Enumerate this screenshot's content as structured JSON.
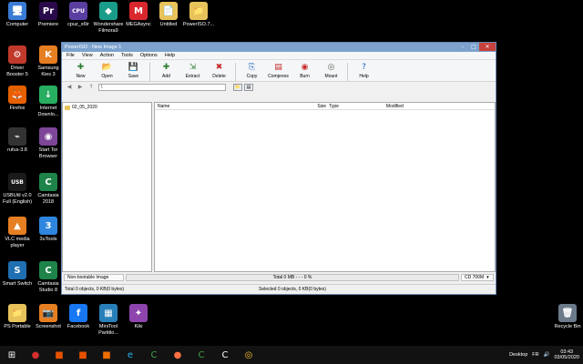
{
  "desktop": {
    "icons": [
      {
        "name": "computer",
        "label": "Computer",
        "glyph": "🖥",
        "color": "#3a7bd5"
      },
      {
        "name": "premiere",
        "label": "Premiere",
        "glyph": "Pr",
        "color": "#2a0a4a"
      },
      {
        "name": "cpuz",
        "label": "cpuz_x6tr",
        "glyph": "CPU",
        "color": "#5b3fa0"
      },
      {
        "name": "wondershare",
        "label": "Wondershare\nFilmora9",
        "glyph": "◆",
        "color": "#1a9c8a"
      },
      {
        "name": "megasync",
        "label": "MEGAsync",
        "glyph": "M",
        "color": "#d9272e"
      },
      {
        "name": "untitled",
        "label": "Untitled",
        "glyph": "📄",
        "color": "#e8c25a"
      },
      {
        "name": "poweriso-shortcut",
        "label": "PowerISO.7...",
        "glyph": "📁",
        "color": "#e8c25a"
      },
      {
        "name": "driver-booster",
        "label": "Driver\nBooster 5",
        "glyph": "⚙",
        "color": "#c0392b"
      },
      {
        "name": "samsung-kies",
        "label": "Samsung\nKies 3",
        "glyph": "K",
        "color": "#e67e22"
      },
      {
        "name": "firefox",
        "label": "Firefox",
        "glyph": "🦊",
        "color": "#e66000"
      },
      {
        "name": "internet-download",
        "label": "Internet\nDownlo...",
        "glyph": "↓",
        "color": "#27ae60"
      },
      {
        "name": "rufus",
        "label": "rufus-3.8",
        "glyph": "⌁",
        "color": "#333333"
      },
      {
        "name": "tor-browser",
        "label": "Start Tor\nBrowser",
        "glyph": "◉",
        "color": "#7d4698"
      },
      {
        "name": "usbutil",
        "label": "USBUtil v2.0\nFull (English)",
        "glyph": "USB",
        "color": "#1a1a1a"
      },
      {
        "name": "camtasia-2018",
        "label": "Camtasia\n2018",
        "glyph": "C",
        "color": "#1e8449"
      },
      {
        "name": "vlc",
        "label": "VLC media\nplayer",
        "glyph": "▲",
        "color": "#e67e22"
      },
      {
        "name": "3utools",
        "label": "3uTools",
        "glyph": "3",
        "color": "#2e86de"
      },
      {
        "name": "smart-switch",
        "label": "Smart Switch",
        "glyph": "S",
        "color": "#1f6fb2"
      },
      {
        "name": "camtasia-studio-8",
        "label": "Camtasia\nStudio 8",
        "glyph": "C",
        "color": "#1e8449"
      },
      {
        "name": "ps-portable",
        "label": "PS Portable",
        "glyph": "📁",
        "color": "#e8c25a"
      },
      {
        "name": "screenshot",
        "label": "Screenshot",
        "glyph": "📷",
        "color": "#e67e22"
      },
      {
        "name": "facebook",
        "label": "Facebook",
        "glyph": "f",
        "color": "#1877f2"
      },
      {
        "name": "minitool",
        "label": "MiniTool\nPartitio...",
        "glyph": "▦",
        "color": "#2980b9"
      },
      {
        "name": "kiki",
        "label": "Kiki",
        "glyph": "✦",
        "color": "#8e44ad"
      },
      {
        "name": "recycle-bin",
        "label": "Recycle Bin",
        "glyph": "🗑",
        "color": "#6b7b8c"
      }
    ]
  },
  "window": {
    "title": "PowerISO - New Image 1",
    "menu": [
      "File",
      "View",
      "Action",
      "Tools",
      "Options",
      "Help"
    ],
    "toolbar": [
      {
        "name": "new",
        "label": "New",
        "glyph": "✚",
        "color": "#2e7d32"
      },
      {
        "name": "open",
        "label": "Open",
        "glyph": "📂",
        "color": "#d4a017"
      },
      {
        "name": "save",
        "label": "Save",
        "glyph": "💾",
        "color": "#9e9e9e"
      },
      {
        "name": "add",
        "label": "Add",
        "glyph": "✚",
        "color": "#2e7d32"
      },
      {
        "name": "extract",
        "label": "Extract",
        "glyph": "⇲",
        "color": "#2e7d32"
      },
      {
        "name": "delete",
        "label": "Delete",
        "glyph": "✖",
        "color": "#c62828"
      },
      {
        "name": "copy",
        "label": "Copy",
        "glyph": "⎘",
        "color": "#1565c0"
      },
      {
        "name": "compress",
        "label": "Compress",
        "glyph": "▤",
        "color": "#c62828"
      },
      {
        "name": "burn",
        "label": "Burn",
        "glyph": "◉",
        "color": "#c62828"
      },
      {
        "name": "mount",
        "label": "Mount",
        "glyph": "◎",
        "color": "#616161"
      },
      {
        "name": "help",
        "label": "Help",
        "glyph": "?",
        "color": "#1565c0"
      }
    ],
    "address": "\\",
    "tree_root": "02_05_2020",
    "columns": {
      "name": "Name",
      "size": "Size",
      "type": "Type",
      "modified": "Modified"
    },
    "status": {
      "boot": "Non-bootable Image",
      "total": "Total 0 MB  - - -  0 %",
      "media": "CD 700M",
      "left": "Total 0 objects, 0 KB(0 bytes)",
      "right": "Selected 0 objects, 0 KB(0 bytes)"
    }
  },
  "taskbar": {
    "items": [
      {
        "name": "start",
        "glyph": "⊞",
        "color": "#ffffff"
      },
      {
        "name": "app-red",
        "glyph": "●",
        "color": "#d32f2f"
      },
      {
        "name": "app-orange-1",
        "glyph": "■",
        "color": "#e65100"
      },
      {
        "name": "app-orange-2",
        "glyph": "■",
        "color": "#e65100"
      },
      {
        "name": "app-orange-3",
        "glyph": "■",
        "color": "#ef6c00"
      },
      {
        "name": "internet-explorer",
        "glyph": "e",
        "color": "#29b6f6"
      },
      {
        "name": "camtasia-task-1",
        "glyph": "C",
        "color": "#43a047"
      },
      {
        "name": "firefox-task",
        "glyph": "●",
        "color": "#ff7043"
      },
      {
        "name": "camtasia-task-2",
        "glyph": "C",
        "color": "#43a047"
      },
      {
        "name": "camtasia-task-3",
        "glyph": "C",
        "color": "#ffffff"
      },
      {
        "name": "disc-task",
        "glyph": "◎",
        "color": "#fbc02d"
      }
    ],
    "desktop_label": "Desktop",
    "lang": "FR",
    "time": "03:43",
    "date": "03/05/2020"
  }
}
